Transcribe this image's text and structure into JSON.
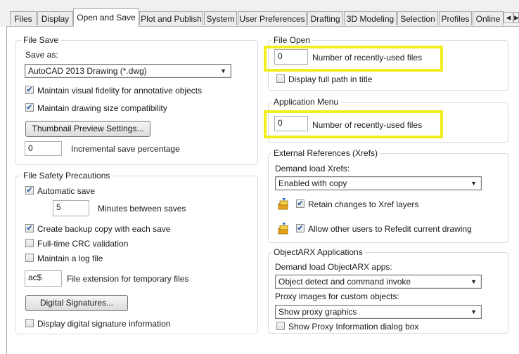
{
  "tabs": [
    "Files",
    "Display",
    "Open and Save",
    "Plot and Publish",
    "System",
    "User Preferences",
    "Drafting",
    "3D Modeling",
    "Selection",
    "Profiles",
    "Online"
  ],
  "active_tab": "Open and Save",
  "nav_icons": {
    "left": "chevron-left-icon",
    "right": "chevron-right-icon"
  },
  "file_save": {
    "title": "File Save",
    "save_as_label": "Save as:",
    "save_as_value": "AutoCAD 2013 Drawing (*.dwg)",
    "visual_fidelity": "Maintain visual fidelity for annotative objects",
    "size_compat": "Maintain drawing size compatibility",
    "thumbnail_btn": "Thumbnail Preview Settings...",
    "incremental_value": "0",
    "incremental_label": "Incremental save percentage"
  },
  "file_safety": {
    "title": "File Safety Precautions",
    "auto_save": "Automatic save",
    "minutes_value": "5",
    "minutes_label": "Minutes between saves",
    "backup": "Create backup copy with each save",
    "crc": "Full-time CRC validation",
    "log": "Maintain a log file",
    "ext_value": "ac$",
    "ext_label": "File extension for temporary files",
    "digital_btn": "Digital Signatures...",
    "digital_info": "Display digital signature information"
  },
  "file_open": {
    "title": "File Open",
    "recent_value": "0",
    "recent_label": "Number of recently-used files",
    "full_path": "Display full path in title"
  },
  "app_menu": {
    "title": "Application Menu",
    "recent_value": "0",
    "recent_label": "Number of recently-used files"
  },
  "xrefs": {
    "title": "External References (Xrefs)",
    "demand_label": "Demand load Xrefs:",
    "demand_value": "Enabled with copy",
    "retain": "Retain changes to Xref layers",
    "allow": "Allow other users to Refedit current drawing"
  },
  "objectarx": {
    "title": "ObjectARX Applications",
    "demand_label": "Demand load ObjectARX apps:",
    "demand_value": "Object detect and command invoke",
    "proxy_label": "Proxy images for custom objects:",
    "proxy_value": "Show proxy graphics",
    "proxy_dialog": "Show Proxy Information dialog box"
  },
  "colors": {
    "highlight": "#f2ee1e",
    "check": "#1d4ea0",
    "group_border": "#d5dbe3"
  }
}
